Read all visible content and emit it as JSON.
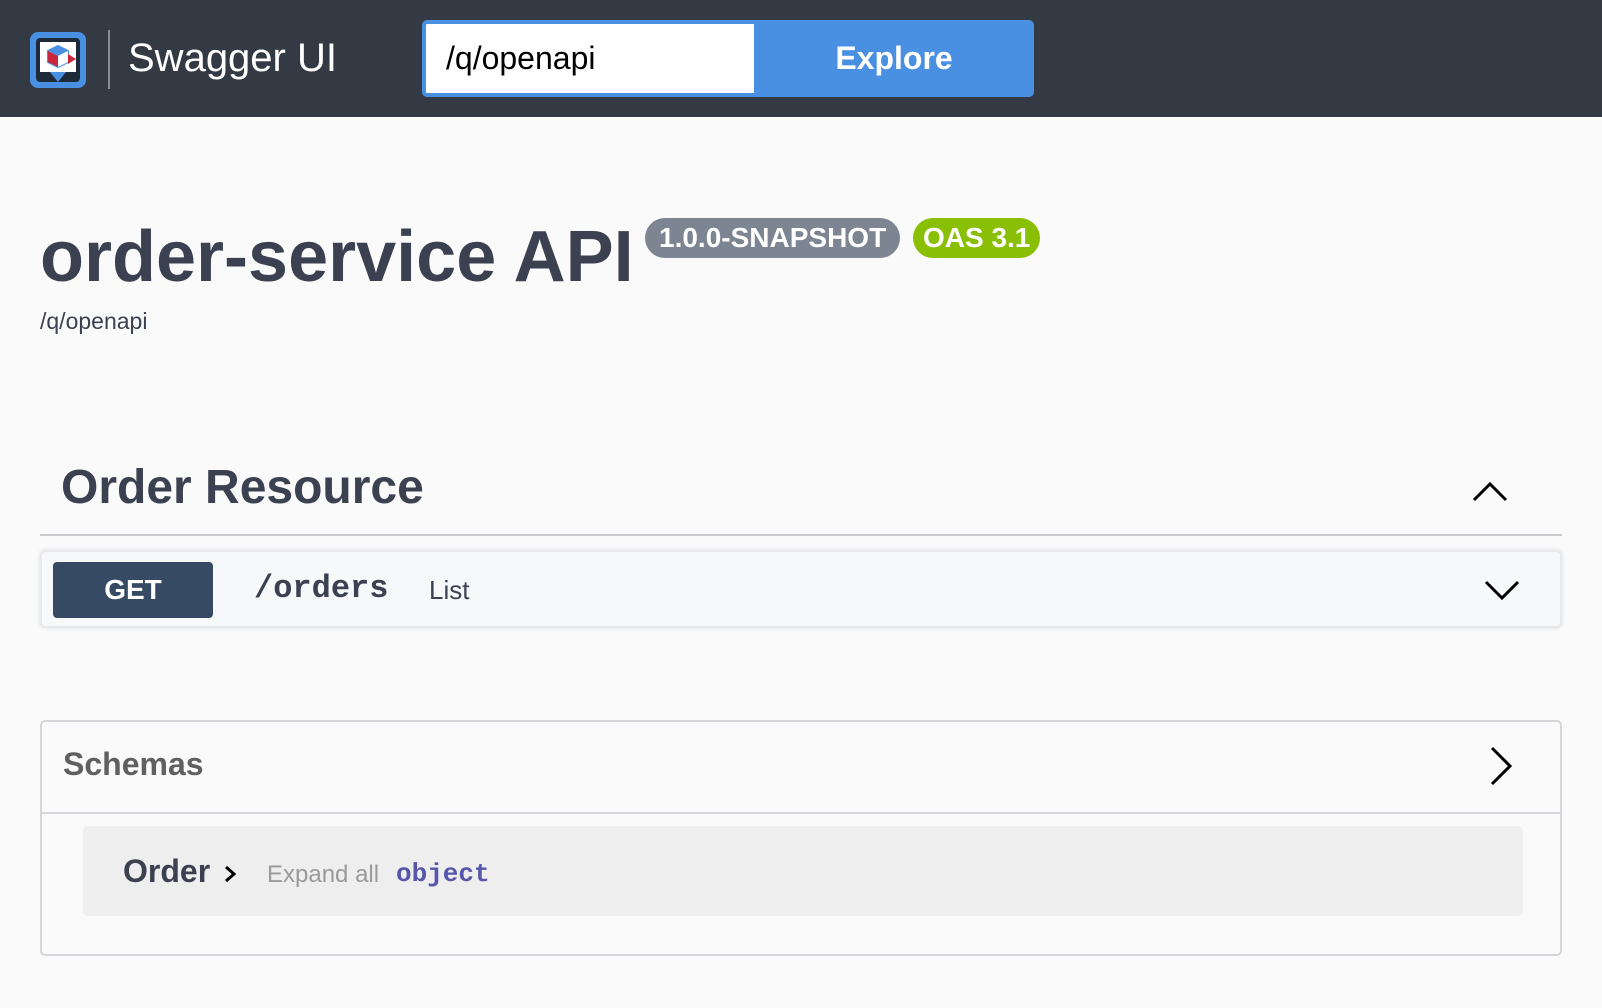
{
  "topbar": {
    "logo_text": "Swagger UI",
    "url_value": "/q/openapi",
    "explore_label": "Explore"
  },
  "info": {
    "title": "order-service API",
    "version_badge": "1.0.0-SNAPSHOT",
    "oas_badge": "OAS 3.1",
    "url_link": "/q/openapi"
  },
  "tags": [
    {
      "name": "Order Resource",
      "expanded": true,
      "operations": [
        {
          "method": "GET",
          "path": "/orders",
          "summary": "List"
        }
      ]
    }
  ],
  "schemas": {
    "title": "Schemas",
    "models": [
      {
        "name": "Order",
        "expand_label": "Expand all",
        "type": "object"
      }
    ]
  },
  "colors": {
    "topbar_bg": "#343a43",
    "explore_blue": "#4990e2",
    "version_badge": "#7d8492",
    "oas_badge": "#89bf04",
    "get_badge": "#364a63",
    "text": "#3b4151",
    "schema_type": "#5555aa"
  },
  "icons": {
    "logo": "swagger-logo-icon",
    "tag_toggle": "chevron-up-icon",
    "op_toggle": "chevron-down-icon",
    "schemas_toggle": "chevron-right-icon",
    "model_toggle": "chevron-right-icon"
  }
}
